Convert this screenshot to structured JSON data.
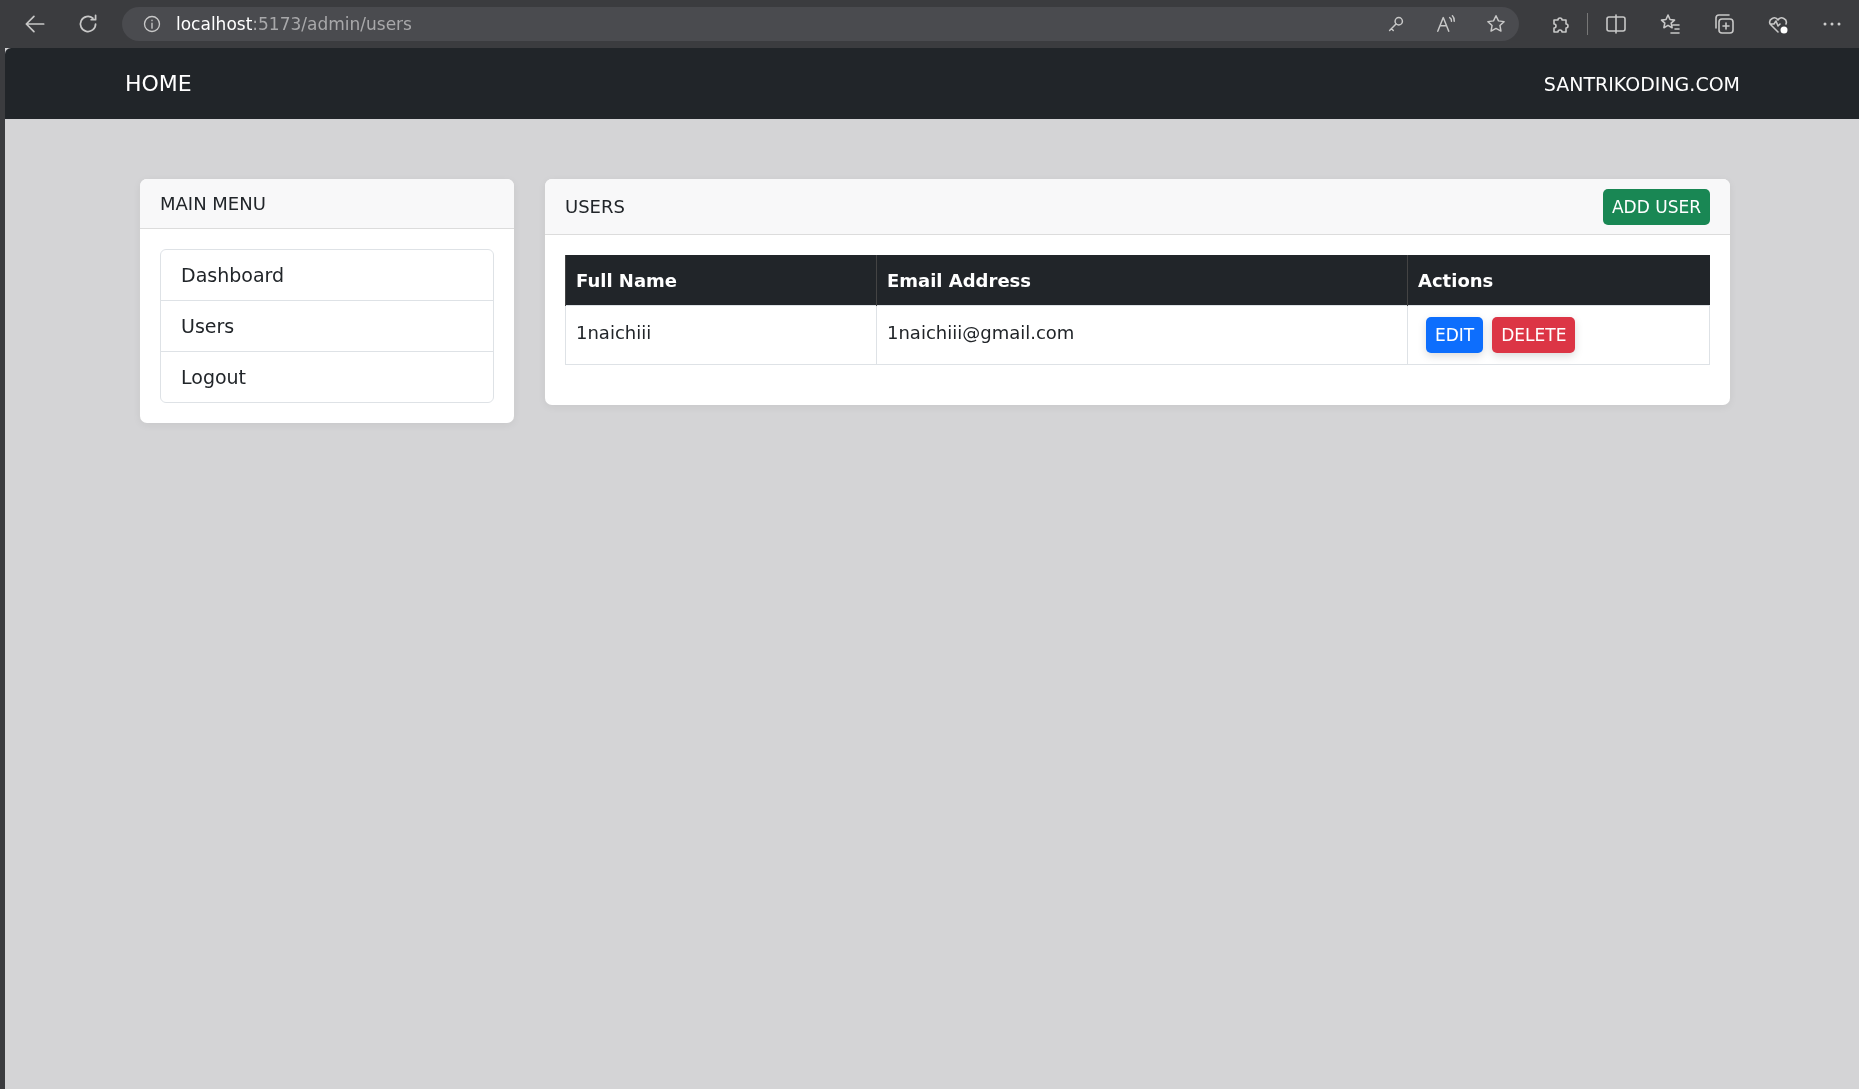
{
  "browser": {
    "url_host": "localhost",
    "url_path": ":5173/admin/users"
  },
  "navbar": {
    "brand": "HOME",
    "right_link": "SANTRIKODING.COM"
  },
  "sidebar": {
    "title": "MAIN MENU",
    "items": [
      {
        "label": "Dashboard"
      },
      {
        "label": "Users"
      },
      {
        "label": "Logout"
      }
    ]
  },
  "users_card": {
    "title": "USERS",
    "add_button": "ADD USER",
    "table": {
      "columns": [
        "Full Name",
        "Email Address",
        "Actions"
      ],
      "rows": [
        {
          "full_name": "1naichiii",
          "email": "1naichiii@gmail.com",
          "actions": [
            "EDIT",
            "DELETE"
          ]
        }
      ]
    }
  }
}
